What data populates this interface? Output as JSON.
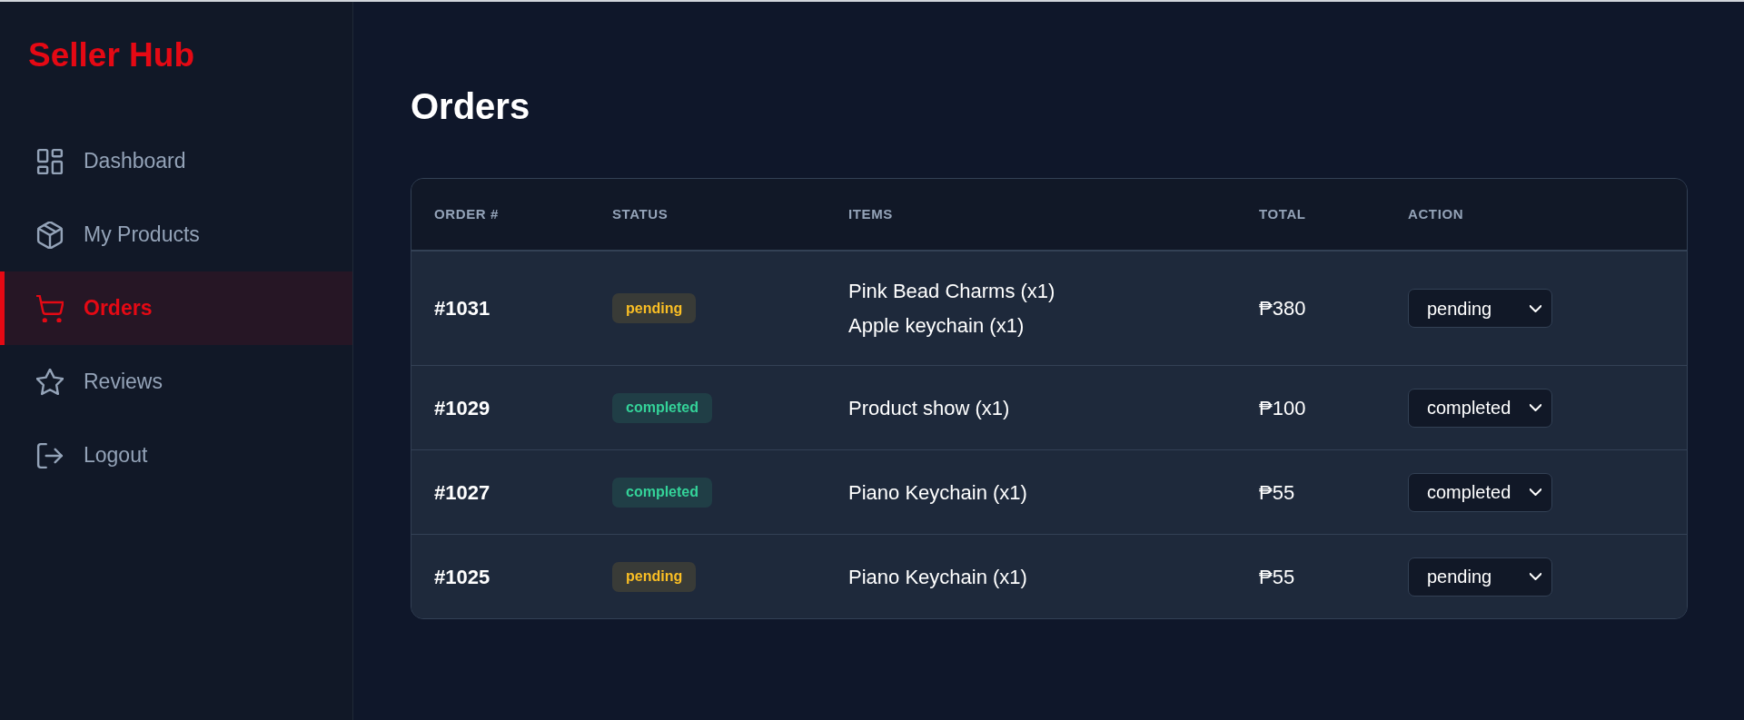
{
  "sidebar": {
    "logo": "Seller Hub",
    "items": [
      {
        "label": "Dashboard",
        "selected": false
      },
      {
        "label": "My Products",
        "selected": false
      },
      {
        "label": "Orders",
        "selected": true
      },
      {
        "label": "Reviews",
        "selected": false
      },
      {
        "label": "Logout",
        "selected": false
      }
    ]
  },
  "page": {
    "title": "Orders"
  },
  "table": {
    "columns": [
      "ORDER #",
      "STATUS",
      "ITEMS",
      "TOTAL",
      "ACTION"
    ],
    "rows": [
      {
        "order": "#1031",
        "status": {
          "label": "pending",
          "color": "#fbbf24"
        },
        "items": [
          "Pink Bead Charms (x1)",
          "Apple keychain (x1)"
        ],
        "total": "₱380",
        "action": "pending"
      },
      {
        "order": "#1029",
        "status": {
          "label": "completed",
          "color": "#34d399"
        },
        "items": [
          "Product show (x1)"
        ],
        "total": "₱100",
        "action": "completed"
      },
      {
        "order": "#1027",
        "status": {
          "label": "completed",
          "color": "#34d399"
        },
        "items": [
          "Piano Keychain (x1)"
        ],
        "total": "₱55",
        "action": "completed"
      },
      {
        "order": "#1025",
        "status": {
          "label": "pending",
          "color": "#fbbf24"
        },
        "items": [
          "Piano Keychain (x1)"
        ],
        "total": "₱55",
        "action": "pending"
      }
    ]
  }
}
